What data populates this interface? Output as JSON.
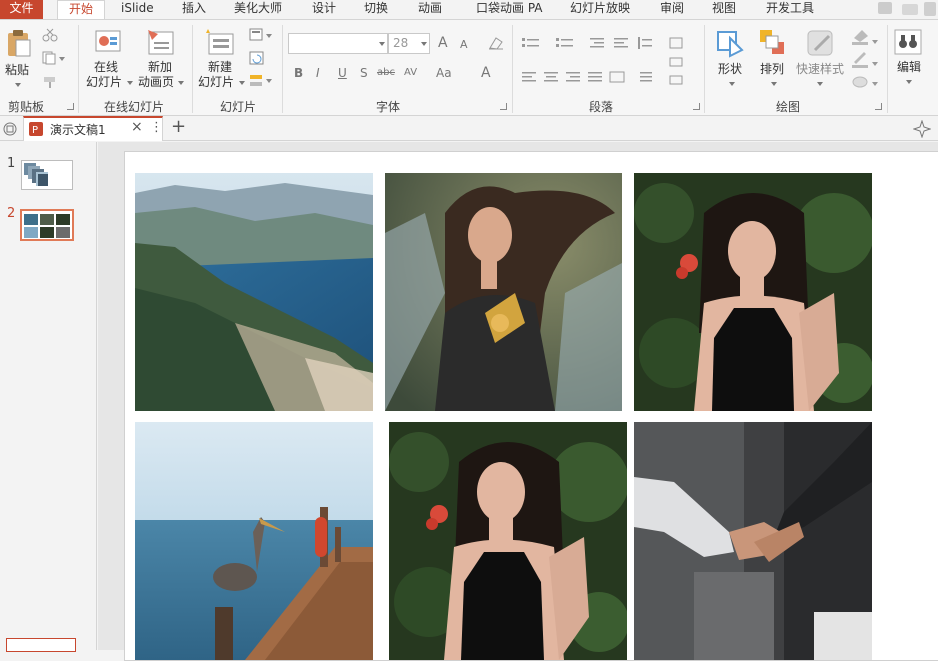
{
  "tabs": [
    {
      "label": "文件"
    },
    {
      "label": "开始"
    },
    {
      "label": "iSlide"
    },
    {
      "label": "插入"
    },
    {
      "label": "美化大师"
    },
    {
      "label": "设计"
    },
    {
      "label": "切换"
    },
    {
      "label": "动画"
    },
    {
      "label": "口袋动画 PA"
    },
    {
      "label": "幻灯片放映"
    },
    {
      "label": "审阅"
    },
    {
      "label": "视图"
    },
    {
      "label": "开发工具"
    }
  ],
  "ribbon": {
    "clipboard": {
      "paste": "粘贴",
      "group": "剪贴板"
    },
    "online": {
      "btn1_line1": "在线",
      "btn1_line2": "幻灯片",
      "btn2_line1": "新加",
      "btn2_line2": "动画页",
      "group": "在线幻灯片"
    },
    "slides": {
      "new_line1": "新建",
      "new_line2": "幻灯片",
      "group": "幻灯片"
    },
    "font": {
      "name_value": "",
      "size_value": "28",
      "bold": "B",
      "italic": "I",
      "underline": "U",
      "shadow": "S",
      "strike": "abc",
      "spacing": "AV",
      "case": "Aa",
      "color": "A",
      "grow": "A",
      "shrink": "A",
      "group": "字体"
    },
    "paragraph": {
      "group": "段落"
    },
    "drawing": {
      "shape": "形状",
      "arrange": "排列",
      "quick_style": "快速样式",
      "group": "绘图"
    },
    "editing": {
      "edit": "编辑"
    }
  },
  "document": {
    "tab_title": "演示文稿1",
    "close": "×",
    "more": "⋮",
    "new_tab": "+"
  },
  "slides": [
    {
      "number": "1"
    },
    {
      "number": "2"
    }
  ],
  "colors": {
    "accent": "#c7472e",
    "selection": "#e07a57"
  }
}
